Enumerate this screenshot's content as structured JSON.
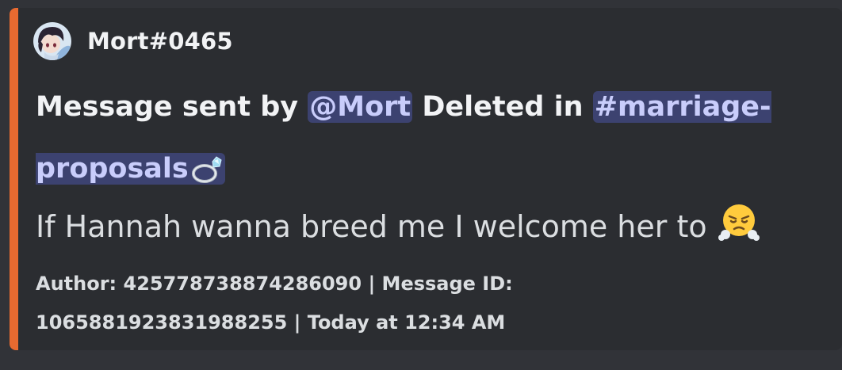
{
  "embed": {
    "accent_color": "#e86a30",
    "author": {
      "name": "Mort#0465",
      "avatar": "user-avatar"
    },
    "title": {
      "prefix": "Message sent by ",
      "user_mention": "@Mort",
      "middle": " Deleted in ",
      "channel_mention": "#marriage-proposals",
      "channel_emoji": "ring-icon"
    },
    "description": {
      "text": "If Hannah wanna breed me I welcome her to",
      "emoji": "face-with-steam-icon"
    },
    "footer": {
      "text": "Author: 425778738874286090 | Message ID: 1065881923831988255 | Today at 12:34 AM"
    }
  }
}
